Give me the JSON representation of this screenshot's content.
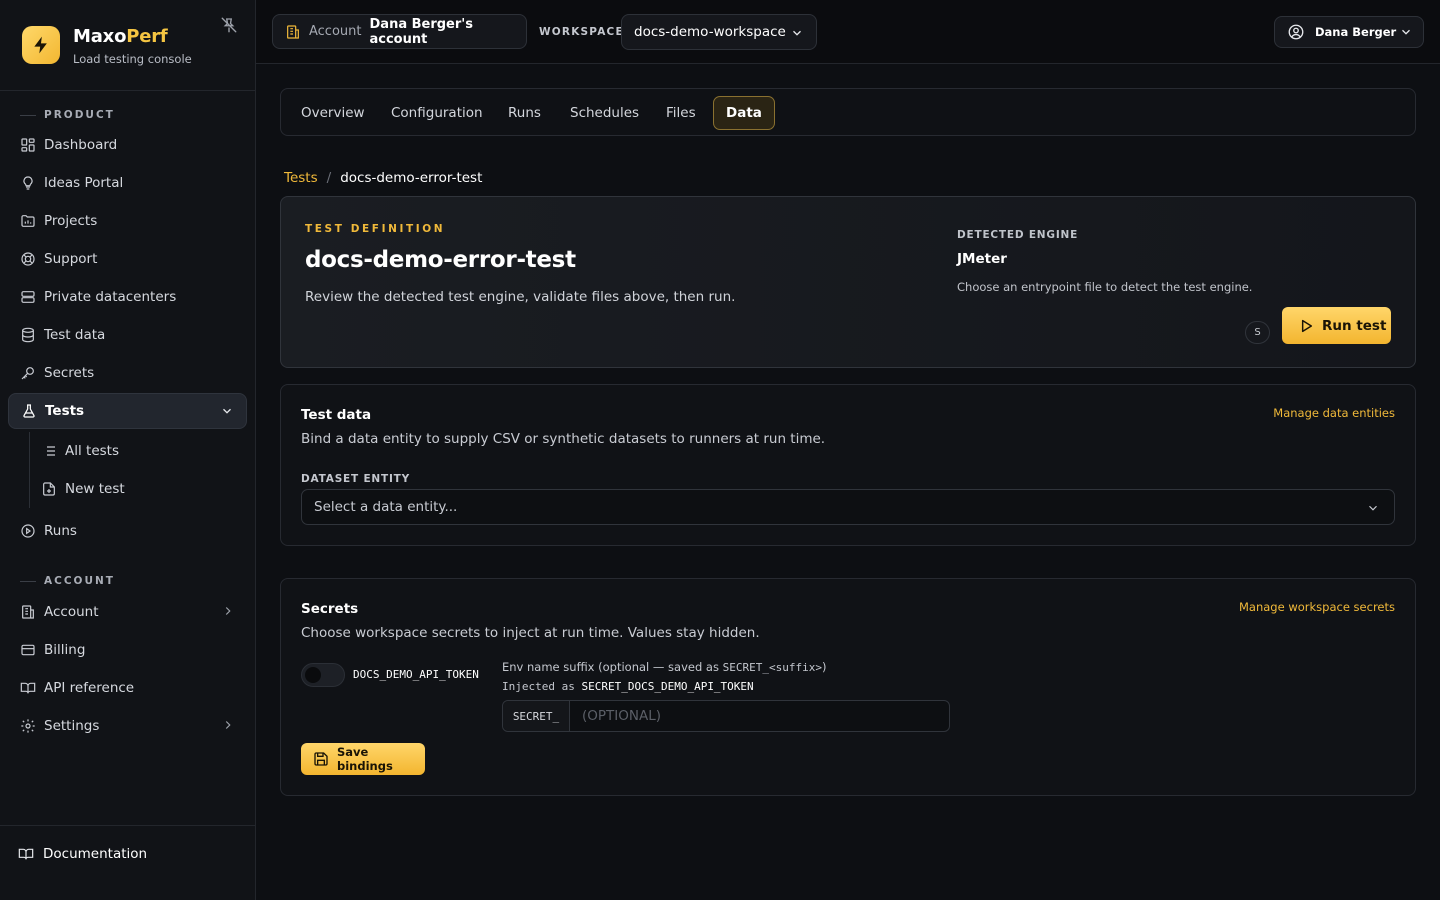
{
  "brand": {
    "name_part1": "Maxo",
    "name_part2": "Perf",
    "subtitle": "Load testing console"
  },
  "sidebar": {
    "product_label": "PRODUCT",
    "account_label": "ACCOUNT",
    "items": [
      {
        "label": "Dashboard"
      },
      {
        "label": "Ideas Portal"
      },
      {
        "label": "Projects"
      },
      {
        "label": "Support"
      },
      {
        "label": "Private datacenters"
      },
      {
        "label": "Test data"
      },
      {
        "label": "Secrets"
      },
      {
        "label": "Tests"
      },
      {
        "label": "Runs"
      }
    ],
    "tests_sub": [
      {
        "label": "All tests"
      },
      {
        "label": "New test"
      }
    ],
    "account_items": [
      {
        "label": "Account"
      },
      {
        "label": "Billing"
      },
      {
        "label": "API reference"
      },
      {
        "label": "Settings"
      }
    ],
    "docs_label": "Documentation"
  },
  "topbar": {
    "account_key": "Account",
    "account_value": "Dana Berger's account",
    "workspace_label": "WORKSPACE",
    "workspace_value": "docs-demo-workspace",
    "user_name": "Dana Berger"
  },
  "tabs": [
    {
      "label": "Overview"
    },
    {
      "label": "Configuration"
    },
    {
      "label": "Runs"
    },
    {
      "label": "Schedules"
    },
    {
      "label": "Files"
    },
    {
      "label": "Data"
    }
  ],
  "breadcrumb": {
    "root": "Tests",
    "separator": "/",
    "current": "docs-demo-error-test"
  },
  "definition": {
    "kicker": "TEST DEFINITION",
    "title": "docs-demo-error-test",
    "description": "Review the detected test engine, validate files above, then run.",
    "engine_label": "DETECTED ENGINE",
    "engine_value": "JMeter",
    "engine_hint": "Choose an entrypoint file to detect the test engine.",
    "shortcut_key": "S",
    "run_label": "Run test"
  },
  "test_data": {
    "title": "Test data",
    "description": "Bind a data entity to supply CSV or synthetic datasets to runners at run time.",
    "manage_link": "Manage data entities",
    "field_label": "DATASET ENTITY",
    "select_placeholder": "Select a data entity..."
  },
  "secrets": {
    "title": "Secrets",
    "description": "Choose workspace secrets to inject at run time. Values stay hidden.",
    "manage_link": "Manage workspace secrets",
    "secret_name": "DOCS_DEMO_API_TOKEN",
    "suffix_label_text": "Env name suffix (optional — saved as ",
    "suffix_label_mono": "SECRET_<suffix>",
    "suffix_label_end": ")",
    "injected_prefix": "Injected as ",
    "injected_value": "SECRET_DOCS_DEMO_API_TOKEN",
    "input_prefix": "SECRET_",
    "input_placeholder": "(OPTIONAL)",
    "toggle_on": false,
    "save_label": "Save bindings"
  },
  "colors": {
    "accent": "#f0b93a",
    "background": "#0d0f13",
    "sidebar": "#111317"
  }
}
